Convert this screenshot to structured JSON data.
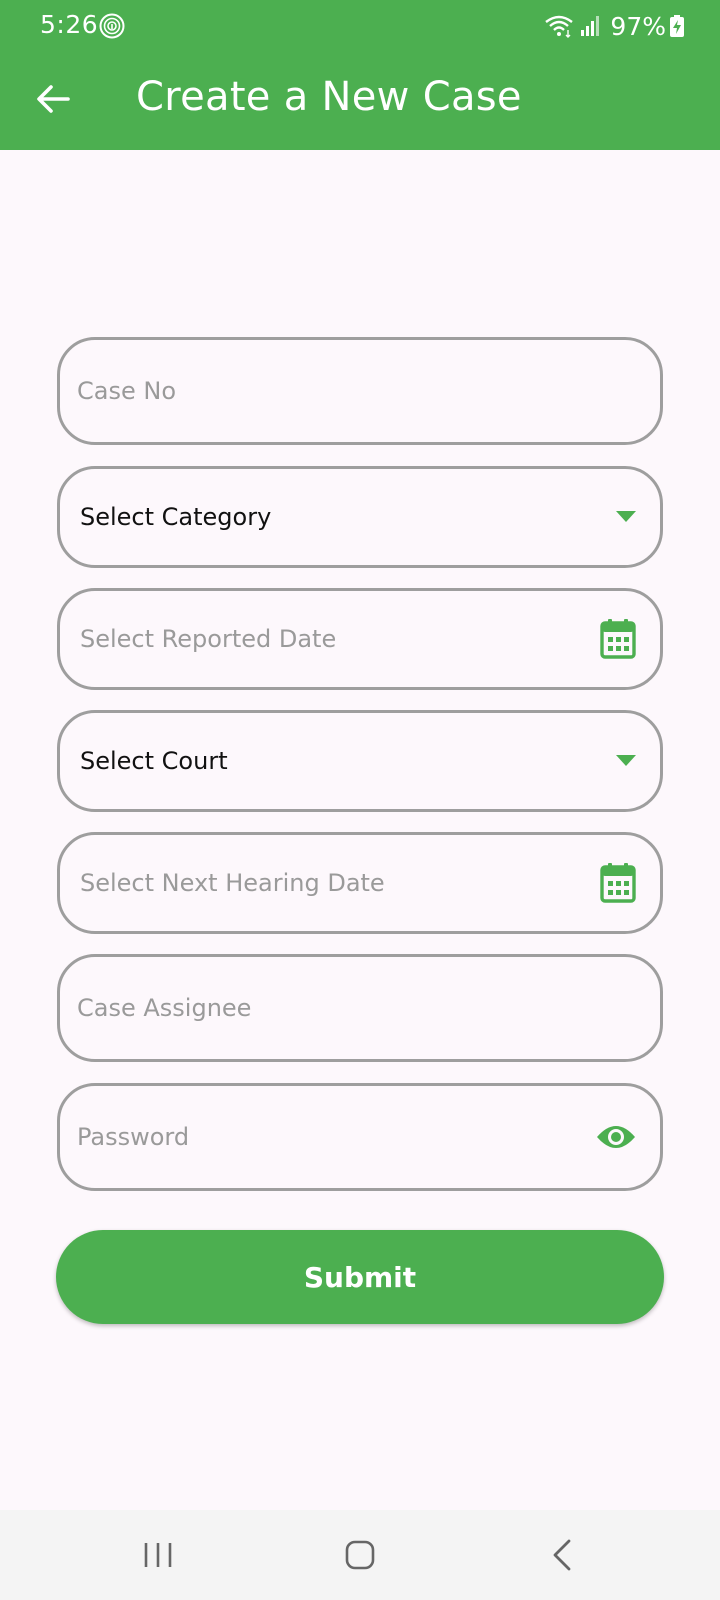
{
  "status_bar": {
    "time": "5:26",
    "battery": "97%"
  },
  "app_bar": {
    "title": "Create a New Case",
    "back_icon": "arrow-left-icon"
  },
  "form": {
    "case_no": {
      "placeholder": "Case No",
      "value": ""
    },
    "category": {
      "label": "Select Category",
      "icon": "dropdown-arrow-icon"
    },
    "reported_date": {
      "placeholder": "Select Reported Date",
      "icon": "calendar-icon"
    },
    "court": {
      "label": "Select Court",
      "icon": "dropdown-arrow-icon"
    },
    "next_hearing_date": {
      "placeholder": "Select Next Hearing Date",
      "icon": "calendar-icon"
    },
    "case_assignee": {
      "placeholder": "Case Assignee",
      "value": ""
    },
    "password": {
      "placeholder": "Password",
      "value": "",
      "icon": "eye-icon"
    },
    "submit_label": "Submit"
  },
  "colors": {
    "primary": "#4caf50",
    "border": "#9e9e9e",
    "background": "#fdf8fc",
    "placeholder": "#9a9a9a"
  },
  "nav_bar": {
    "icons": [
      "recents-icon",
      "home-icon",
      "back-icon"
    ]
  }
}
